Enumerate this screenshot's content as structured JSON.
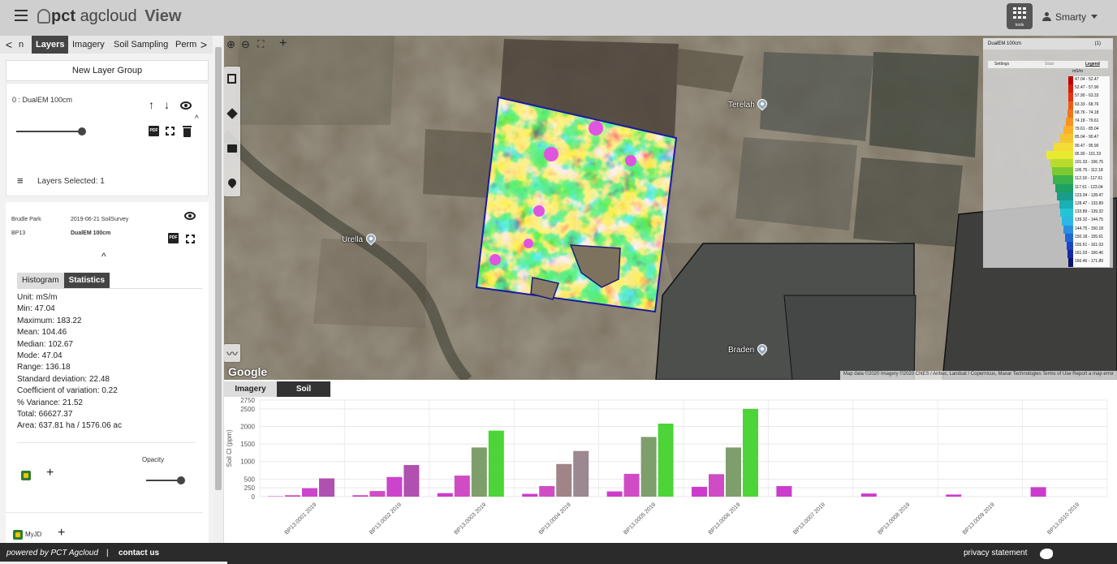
{
  "header": {
    "logo_pct": "pct",
    "logo_agcloud": "agcloud",
    "logo_view": "View",
    "apps_label": "tools",
    "user_name": "Smarty"
  },
  "left_tabs": {
    "prev": "<",
    "items": [
      "n",
      "Layers",
      "Imagery",
      "Soil Sampling",
      "Perm"
    ],
    "next": ">"
  },
  "layers": {
    "new_group_label": "New Layer Group",
    "layer_name": "0 : DualEM 100cm",
    "selected_label": "Layers Selected: 1"
  },
  "detail": {
    "farm": "Brudle Park",
    "survey": "2019-06-21 SoilSurvey",
    "paddock": "BP13",
    "layer": "DualEM 100cm",
    "tabs": [
      "Histogram",
      "Statistics"
    ],
    "stats": [
      "Unit: mS/m",
      "Min: 47.04",
      "Maximum: 183.22",
      "Mean: 104.46",
      "Median: 102.67",
      "Mode: 47.04",
      "Range: 136.18",
      "Standard deviation: 22.48",
      "Coefficient of variation: 0.22",
      "% Variance: 21.52",
      "Total: 66627.37",
      "Area: 637.81 ha / 1576.06 ac"
    ],
    "opacity_label": "Opacity",
    "myjd_label": "MyJD",
    "opacity": 1.0
  },
  "map": {
    "labels": {
      "terelah": "Terelah",
      "urella": "Urella",
      "braden": "Braden"
    },
    "google": "Google",
    "attribution": "Map data ©2020 Imagery ©2020 CNES / Airbus, Landsat / Copernicus, Maxar Technologies   Terms of Use   Report a map error"
  },
  "legend": {
    "title": "DualEM 100cm",
    "count": "(1)",
    "tabs": [
      "Settings",
      "Stats",
      "Legend"
    ],
    "unit": "mS/m",
    "rows": [
      {
        "range": "47.04 - 52.47",
        "color": "#c00000",
        "share": 0.02
      },
      {
        "range": "52.47 - 57.90",
        "color": "#d81a08",
        "share": 0.03
      },
      {
        "range": "57.90 - 63.33",
        "color": "#e53410",
        "share": 0.04
      },
      {
        "range": "63.33 - 68.76",
        "color": "#ee5a14",
        "share": 0.08
      },
      {
        "range": "68.76 - 74.18",
        "color": "#f3761a",
        "share": 0.12
      },
      {
        "range": "74.18 - 79.61",
        "color": "#f79322",
        "share": 0.2
      },
      {
        "range": "79.61 - 85.04",
        "color": "#fbb02a",
        "share": 0.3
      },
      {
        "range": "85.04 - 90.47",
        "color": "#f5c431",
        "share": 0.45
      },
      {
        "range": "90.47 - 95.90",
        "color": "#f2dc35",
        "share": 0.7
      },
      {
        "range": "95.90 - 101.33",
        "color": "#e8ea32",
        "share": 1.0
      },
      {
        "range": "101.33 - 106.75",
        "color": "#b8dc2e",
        "share": 0.85
      },
      {
        "range": "106.75 - 112.18",
        "color": "#7cc832",
        "share": 0.78
      },
      {
        "range": "112.18 - 117.61",
        "color": "#3bb34a",
        "share": 0.72
      },
      {
        "range": "117.61 - 123.04",
        "color": "#1fa064",
        "share": 0.64
      },
      {
        "range": "123.04 - 128.47",
        "color": "#1a9c8a",
        "share": 0.56
      },
      {
        "range": "128.47 - 133.89",
        "color": "#1ab0b4",
        "share": 0.48
      },
      {
        "range": "133.89 - 139.32",
        "color": "#25c4d4",
        "share": 0.42
      },
      {
        "range": "139.32 - 144.75",
        "color": "#2bb8e4",
        "share": 0.36
      },
      {
        "range": "144.75 - 150.18",
        "color": "#2a90e0",
        "share": 0.3
      },
      {
        "range": "150.18 - 155.61",
        "color": "#2268d4",
        "share": 0.24
      },
      {
        "range": "155.61 - 161.03",
        "color": "#1b44c4",
        "share": 0.18
      },
      {
        "range": "161.03 - 166.46",
        "color": "#1528a4",
        "share": 0.12
      },
      {
        "range": "166.46 - 171.89",
        "color": "#0d1470",
        "share": 0.06
      }
    ]
  },
  "bottom_tabs": [
    "Imagery",
    "Soil"
  ],
  "chart_data": {
    "type": "bar",
    "ylabel": "Soil Cl (ppm)",
    "ylim": [
      0,
      2750
    ],
    "yticks": [
      0,
      250,
      500,
      1000,
      1500,
      2000,
      2500,
      2750
    ],
    "categories": [
      "BP13.0001 2019",
      "BP13.0002 2019",
      "BP13.0003 2019",
      "BP13.0004 2019",
      "BP13.0005 2019",
      "BP13.0006 2019",
      "BP13.0007 2019",
      "BP13.0008 2019",
      "BP13.0009 2019",
      "BP13.0010 2019"
    ],
    "series": [
      {
        "color": "#cc3ccc",
        "values": [
          10,
          40,
          100,
          80,
          150,
          280,
          300,
          90,
          60,
          270
        ]
      },
      {
        "color": "#d04cc4",
        "values": [
          40,
          160,
          600,
          300,
          650,
          640,
          0,
          0,
          0,
          0
        ]
      },
      {
        "color": "#cc44cc",
        "values": [
          240,
          560,
          0,
          0,
          0,
          0,
          0,
          0,
          0,
          0
        ]
      },
      {
        "color": "#b050b0",
        "values": [
          520,
          900,
          0,
          0,
          0,
          0,
          0,
          0,
          0,
          0
        ]
      },
      {
        "color": "#7e9e6c",
        "values": [
          0,
          0,
          1400,
          0,
          1700,
          1400,
          0,
          0,
          0,
          0
        ]
      },
      {
        "color": "#a08488",
        "values": [
          0,
          0,
          0,
          930,
          0,
          0,
          0,
          0,
          0,
          0
        ]
      },
      {
        "color": "#9c8890",
        "values": [
          0,
          0,
          0,
          1300,
          0,
          0,
          0,
          0,
          0,
          0
        ]
      },
      {
        "color": "#4cd438",
        "values": [
          0,
          0,
          1880,
          0,
          2080,
          2500,
          0,
          0,
          0,
          0
        ]
      }
    ]
  },
  "footer": {
    "powered": "powered by PCT Agcloud",
    "separator": "|",
    "contact": "contact us",
    "privacy": "privacy statement"
  }
}
